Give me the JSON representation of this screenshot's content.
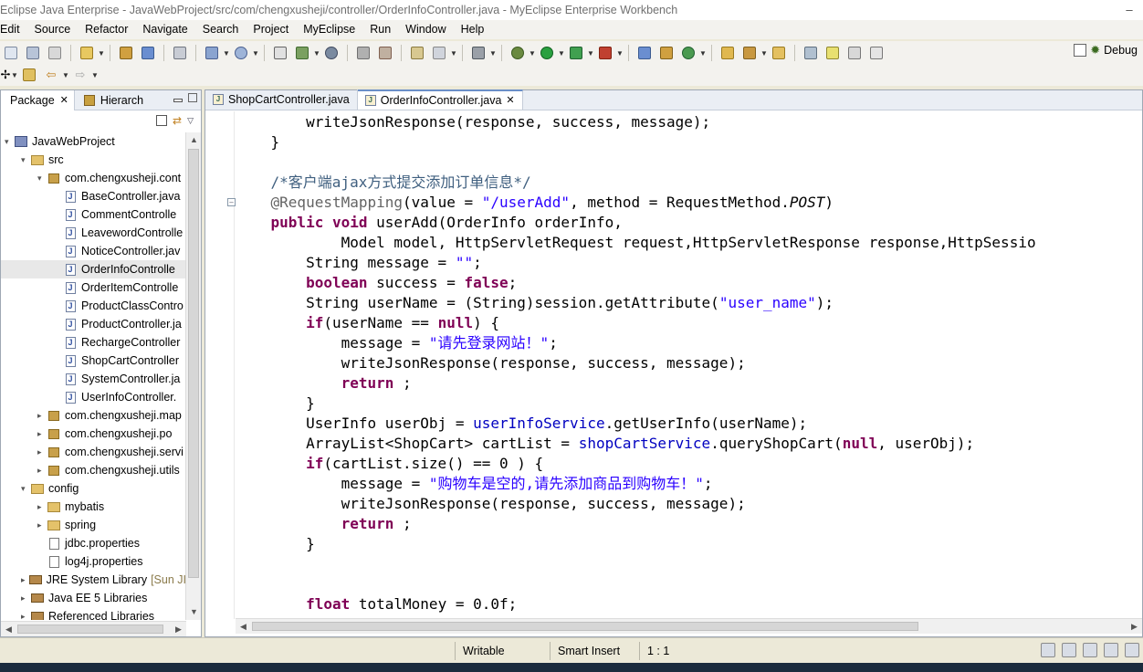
{
  "window": {
    "title": "Eclipse Java Enterprise - JavaWebProject/src/com/chengxusheji/controller/OrderInfoController.java - MyEclipse Enterprise Workbench"
  },
  "menu": [
    "Edit",
    "Source",
    "Refactor",
    "Navigate",
    "Search",
    "Project",
    "MyEclipse",
    "Run",
    "Window",
    "Help"
  ],
  "perspective": {
    "label": "Debug"
  },
  "left_panel": {
    "tabs": [
      {
        "label": "Package",
        "active": true
      },
      {
        "label": "Hierarch",
        "active": false
      }
    ],
    "tree": [
      {
        "label": "JavaWebProject",
        "indent": 0,
        "icon": "project-icon",
        "expander": "▾"
      },
      {
        "label": "src",
        "indent": 1,
        "icon": "folder-icon",
        "expander": "▾"
      },
      {
        "label": "com.chengxusheji.cont",
        "indent": 2,
        "icon": "package-icon",
        "expander": "▾"
      },
      {
        "label": "BaseController.java",
        "indent": 3,
        "icon": "java-file-icon"
      },
      {
        "label": "CommentControlle",
        "indent": 3,
        "icon": "java-file-icon"
      },
      {
        "label": "LeavewordControlle",
        "indent": 3,
        "icon": "java-file-icon"
      },
      {
        "label": "NoticeController.jav",
        "indent": 3,
        "icon": "java-file-icon"
      },
      {
        "label": "OrderInfoControlle",
        "indent": 3,
        "icon": "java-file-icon",
        "selected": true
      },
      {
        "label": "OrderItemControlle",
        "indent": 3,
        "icon": "java-file-icon"
      },
      {
        "label": "ProductClassContro",
        "indent": 3,
        "icon": "java-file-icon"
      },
      {
        "label": "ProductController.ja",
        "indent": 3,
        "icon": "java-file-icon"
      },
      {
        "label": "RechargeController",
        "indent": 3,
        "icon": "java-file-icon"
      },
      {
        "label": "ShopCartController",
        "indent": 3,
        "icon": "java-file-icon"
      },
      {
        "label": "SystemController.ja",
        "indent": 3,
        "icon": "java-file-icon"
      },
      {
        "label": "UserInfoController.",
        "indent": 3,
        "icon": "java-file-icon"
      },
      {
        "label": "com.chengxusheji.map",
        "indent": 2,
        "icon": "package-icon",
        "expander": "▸"
      },
      {
        "label": "com.chengxusheji.po",
        "indent": 2,
        "icon": "package-icon",
        "expander": "▸"
      },
      {
        "label": "com.chengxusheji.servi",
        "indent": 2,
        "icon": "package-icon",
        "expander": "▸"
      },
      {
        "label": "com.chengxusheji.utils",
        "indent": 2,
        "icon": "package-icon",
        "expander": "▸"
      },
      {
        "label": "config",
        "indent": 1,
        "icon": "folder-icon",
        "expander": "▾"
      },
      {
        "label": "mybatis",
        "indent": 2,
        "icon": "folder-icon",
        "expander": "▸"
      },
      {
        "label": "spring",
        "indent": 2,
        "icon": "folder-icon",
        "expander": "▸"
      },
      {
        "label": "jdbc.properties",
        "indent": 2,
        "icon": "file-icon"
      },
      {
        "label": "log4j.properties",
        "indent": 2,
        "icon": "file-icon"
      },
      {
        "label": "JRE System Library",
        "suffix": "[Sun JI",
        "indent": 1,
        "icon": "library-icon",
        "expander": "▸"
      },
      {
        "label": "Java EE 5 Libraries",
        "indent": 1,
        "icon": "library-icon",
        "expander": "▸"
      },
      {
        "label": "Referenced Libraries",
        "indent": 1,
        "icon": "library-icon",
        "expander": "▸"
      }
    ]
  },
  "editor": {
    "tabs": [
      {
        "label": "ShopCartController.java",
        "active": false
      },
      {
        "label": "OrderInfoController.java",
        "active": true
      }
    ],
    "lines": [
      [
        {
          "t": "        writeJsonResponse(response, success, message);"
        }
      ],
      [
        {
          "t": "    }"
        }
      ],
      [
        {
          "t": ""
        }
      ],
      [
        {
          "t": "    /*客户端ajax方式提交添加订单信息*/",
          "c": "cm"
        }
      ],
      [
        {
          "t": "    @RequestMapping",
          "c": "an"
        },
        {
          "t": "(value = "
        },
        {
          "t": "\"/userAdd\"",
          "c": "st"
        },
        {
          "t": ", method = RequestMethod."
        },
        {
          "t": "POST",
          "c": "it"
        },
        {
          "t": ")"
        }
      ],
      [
        {
          "t": "    "
        },
        {
          "t": "public",
          "c": "kw"
        },
        {
          "t": " "
        },
        {
          "t": "void",
          "c": "kw"
        },
        {
          "t": " userAdd(OrderInfo orderInfo,"
        }
      ],
      [
        {
          "t": "            Model model, HttpServletRequest request,HttpServletResponse response,HttpSessio"
        }
      ],
      [
        {
          "t": "        String message = "
        },
        {
          "t": "\"\"",
          "c": "st"
        },
        {
          "t": ";"
        }
      ],
      [
        {
          "t": "        "
        },
        {
          "t": "boolean",
          "c": "kw"
        },
        {
          "t": " success = "
        },
        {
          "t": "false",
          "c": "kw"
        },
        {
          "t": ";"
        }
      ],
      [
        {
          "t": "        String userName = (String)session.getAttribute("
        },
        {
          "t": "\"user_name\"",
          "c": "st"
        },
        {
          "t": ");"
        }
      ],
      [
        {
          "t": "        "
        },
        {
          "t": "if",
          "c": "kw"
        },
        {
          "t": "(userName == "
        },
        {
          "t": "null",
          "c": "kw"
        },
        {
          "t": ") {"
        }
      ],
      [
        {
          "t": "            message = "
        },
        {
          "t": "\"请先登录网站！\"",
          "c": "st"
        },
        {
          "t": ";"
        }
      ],
      [
        {
          "t": "            writeJsonResponse(response, success, message);"
        }
      ],
      [
        {
          "t": "            "
        },
        {
          "t": "return",
          "c": "kw"
        },
        {
          "t": " ;"
        }
      ],
      [
        {
          "t": "        }"
        }
      ],
      [
        {
          "t": "        UserInfo userObj = "
        },
        {
          "t": "userInfoService",
          "c": "fd"
        },
        {
          "t": ".getUserInfo(userName);"
        }
      ],
      [
        {
          "t": "        ArrayList<ShopCart> cartList = "
        },
        {
          "t": "shopCartService",
          "c": "fd"
        },
        {
          "t": ".queryShopCart("
        },
        {
          "t": "null",
          "c": "kw"
        },
        {
          "t": ", userObj);"
        }
      ],
      [
        {
          "t": "        "
        },
        {
          "t": "if",
          "c": "kw"
        },
        {
          "t": "(cartList.size() == 0 ) {"
        }
      ],
      [
        {
          "t": "            message = "
        },
        {
          "t": "\"购物车是空的,请先添加商品到购物车！\"",
          "c": "st"
        },
        {
          "t": ";"
        }
      ],
      [
        {
          "t": "            writeJsonResponse(response, success, message);"
        }
      ],
      [
        {
          "t": "            "
        },
        {
          "t": "return",
          "c": "kw"
        },
        {
          "t": " ;"
        }
      ],
      [
        {
          "t": "        }"
        }
      ],
      [
        {
          "t": ""
        }
      ],
      [
        {
          "t": ""
        }
      ],
      [
        {
          "t": "        "
        },
        {
          "t": "float",
          "c": "kw"
        },
        {
          "t": " totalMoney = 0.0f;"
        }
      ]
    ]
  },
  "status": {
    "writable": "Writable",
    "insert_mode": "Smart Insert",
    "position": "1 : 1"
  }
}
